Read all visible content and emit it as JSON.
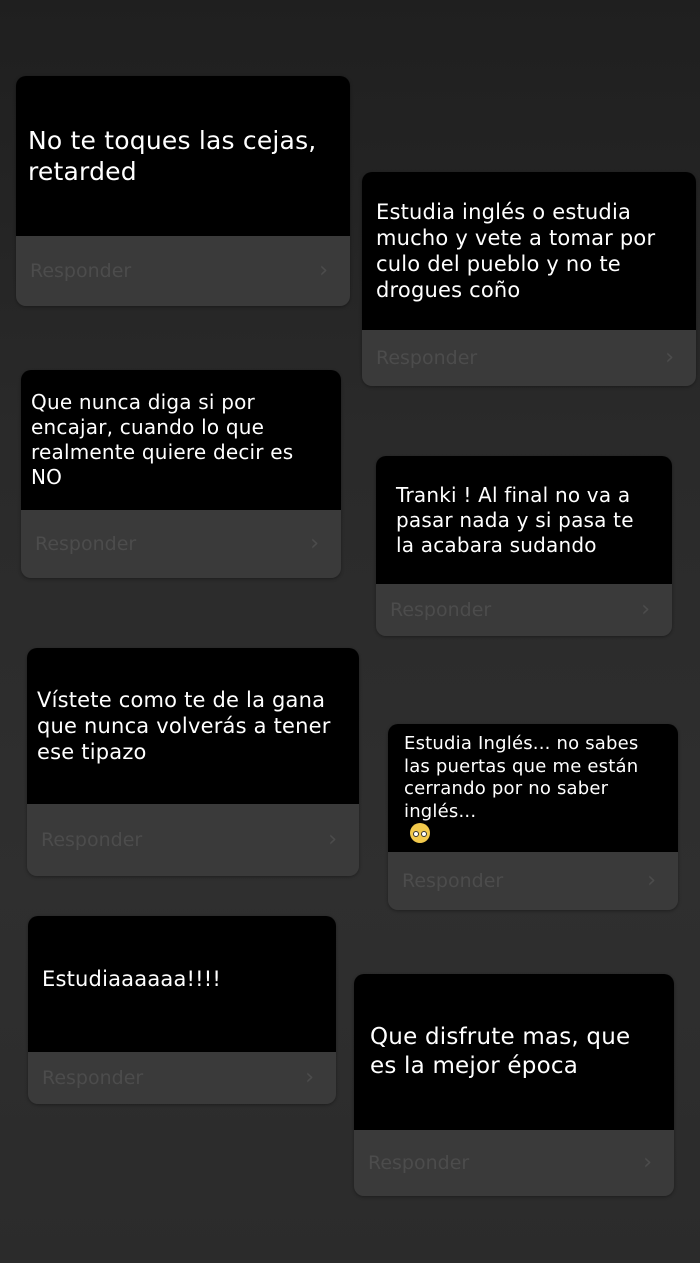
{
  "reply_label": "Responder",
  "chevron_icon": "chevron-right-icon",
  "colors": {
    "background": "#2a2a2a",
    "question_bg": "#000000",
    "question_text": "#ffffff",
    "reply_bg": "#3a3a3a",
    "reply_text": "#4c4c4c"
  },
  "responses": [
    {
      "text": "No te toques las cejas, retarded"
    },
    {
      "text": "Estudia inglés o estudia mucho y vete a tomar por culo del pueblo y no te drogues coño"
    },
    {
      "text": "Que nunca diga si por encajar, cuando lo que realmente quiere decir es NO"
    },
    {
      "text": "Tranki ! Al final no va a pasar nada y si pasa te la acabara sudando"
    },
    {
      "text": "Vístete como te de la gana que nunca volverás a tener ese tipazo"
    },
    {
      "text": "Estudia Inglés... no sabes las puertas que me están cerrando por no saber inglés...",
      "emoji": "pleading-face-emoji"
    },
    {
      "text": "Estudiaaaaaa!!!!"
    },
    {
      "text": "Que disfrute mas, que es la mejor época"
    }
  ]
}
